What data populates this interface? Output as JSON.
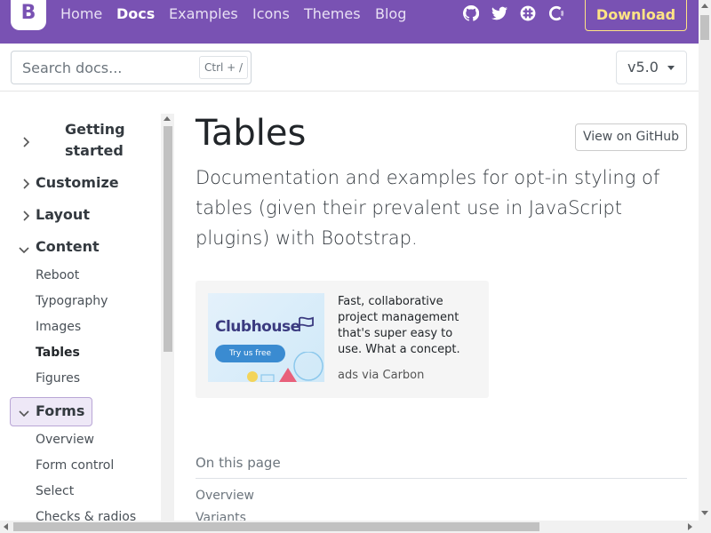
{
  "navbar": {
    "brand": "B",
    "links": [
      "Home",
      "Docs",
      "Examples",
      "Icons",
      "Themes",
      "Blog"
    ],
    "download": "Download"
  },
  "search": {
    "placeholder": "Search docs...",
    "shortcut": "Ctrl + /"
  },
  "version": "v5.0",
  "sidebar": {
    "groups": {
      "getting_started_1": "Getting",
      "getting_started_2": "started",
      "customize": "Customize",
      "layout": "Layout",
      "content": "Content",
      "forms": "Forms"
    },
    "content_items": [
      "Reboot",
      "Typography",
      "Images",
      "Tables",
      "Figures"
    ],
    "forms_items": [
      "Overview",
      "Form control",
      "Select",
      "Checks & radios"
    ]
  },
  "main": {
    "title": "Tables",
    "github": "View on GitHub",
    "lead": "Documentation and examples for opt-in styling of tables (given their prevalent use in JavaScript plugins) with Bootstrap.",
    "ad": {
      "logo": "Clubhouse",
      "try": "Try us free",
      "text": "Fast, collaborative project management that's super easy to use. What a concept.",
      "via": "ads via Carbon"
    },
    "on_this_page": "On this page",
    "toc": [
      "Overview",
      "Variants"
    ]
  },
  "colors": {
    "brand": "#7952b3",
    "accent": "#ffe484"
  }
}
